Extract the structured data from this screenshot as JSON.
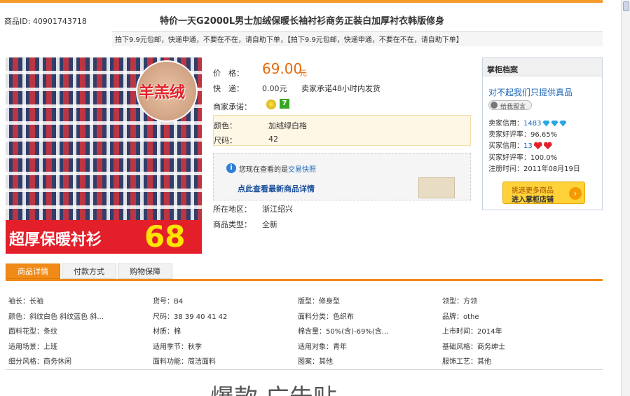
{
  "header": {
    "item_id": "商品ID: 40901743718",
    "title": "特价一天G2000L男士加绒保暖长袖衬衫商务正装白加厚衬衣韩版修身",
    "subtitle": "拍下9.9元包邮，快递申通，不要在不在，请自助下单，【拍下9.9元包邮，快递申通，不要在不在，请自助下单】"
  },
  "product_image": {
    "badge_text": "羊羔绒",
    "banner_text": "超厚保暖衬衫",
    "banner_price": "68"
  },
  "info": {
    "price_label": "价　格：",
    "price": "69.00",
    "price_unit": "元",
    "delivery_label": "快　递：",
    "delivery_fee": "0.00元",
    "delivery_promise": "卖家承诺48小时内发货",
    "promise_label": "商家承诺：",
    "promise_badge_b": "7",
    "color_label": "颜色：",
    "color_value": "加绒绿白格",
    "size_label": "尺码：",
    "size_value": "42",
    "notice_prefix": "您现在查看的是",
    "notice_link": "交易快照",
    "notice_action": "点此查看最新商品详情",
    "region_label": "所在地区：",
    "region_value": "浙江绍兴",
    "type_label": "商品类型：",
    "type_value": "全新"
  },
  "seller": {
    "title": "掌柜档案",
    "name": "对不起我们只提供真品",
    "message_btn": "给我留言",
    "seller_credit_label": "卖家信用：",
    "seller_credit": "1483",
    "seller_good_rate": "卖家好评率：96.65%",
    "buyer_credit_label": "买家信用：",
    "buyer_credit": "13",
    "buyer_good_rate": "买家好评率：100.0%",
    "register_time": "注册时间：2011年08月19日",
    "shop_btn_line1": "挑选更多商品",
    "shop_btn_line2": "进入掌柜店铺",
    "colors": {
      "accent": "#1a66b8",
      "button": "#ffd23a"
    }
  },
  "tabs": [
    "商品详情",
    "付款方式",
    "购物保障"
  ],
  "attributes": [
    [
      "袖长：长袖",
      "货号：B4",
      "版型：修身型",
      "领型：方领"
    ],
    [
      "颜色：斜纹白色 斜纹蓝色 斜...",
      "尺码：38 39 40 41 42",
      "面料分类：色织布",
      "品牌：othe"
    ],
    [
      "面料花型：条纹",
      "材质：棉",
      "棉含量：50%(含)-69%(含...",
      "上市时间：2014年"
    ],
    [
      "适用场景：上班",
      "适用季节：秋季",
      "适用对象：青年",
      "基础风格：商务绅士"
    ],
    [
      "细分风格：商务休闲",
      "面料功能：简洁面料",
      "图案：其他",
      "服饰工艺：其他"
    ]
  ],
  "footer_partial_text": "爆款 广告贴",
  "colors": {
    "orange": "#f08a18",
    "price": "#e36a0c",
    "banner_red": "#e3202a"
  }
}
